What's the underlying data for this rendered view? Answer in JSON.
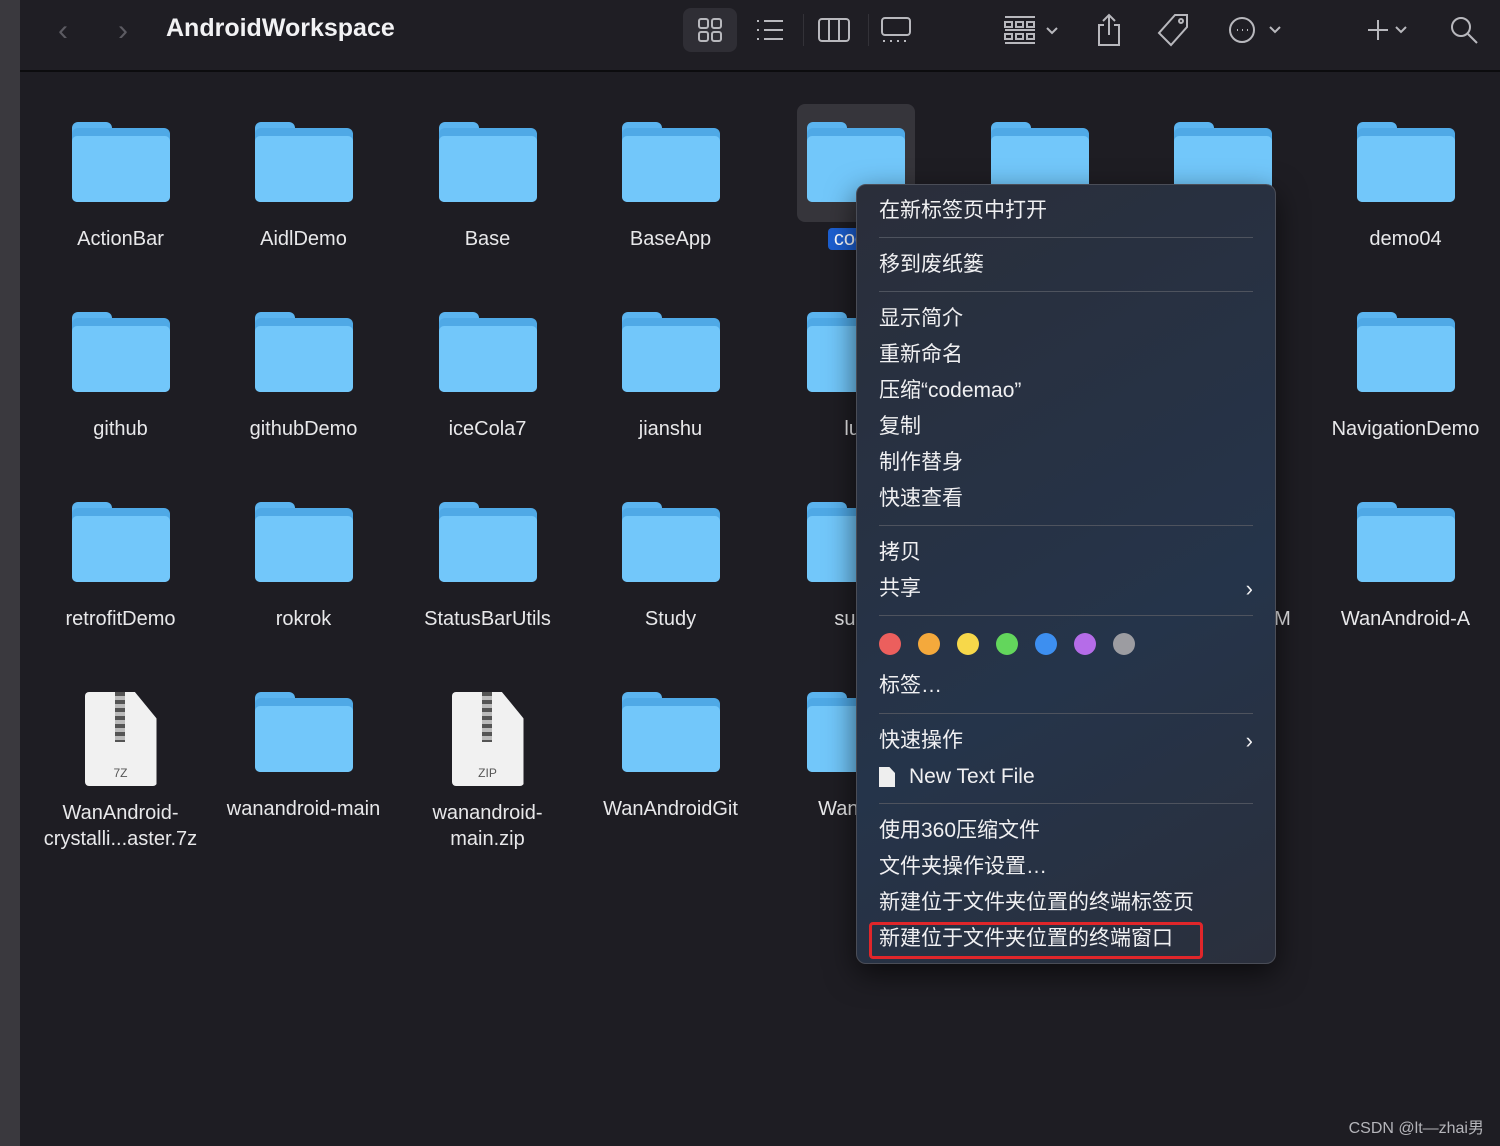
{
  "window": {
    "title": "AndroidWorkspace"
  },
  "toolbar": {
    "back": "‹",
    "forward": "›",
    "icons": [
      "icon-view",
      "list-view",
      "column-view",
      "gallery-view",
      "group-by",
      "share",
      "tag",
      "more-actions",
      "add",
      "search"
    ]
  },
  "items": [
    {
      "name": "ActionBar",
      "type": "folder"
    },
    {
      "name": "AidlDemo",
      "type": "folder"
    },
    {
      "name": "Base",
      "type": "folder"
    },
    {
      "name": "BaseApp",
      "type": "folder"
    },
    {
      "name": "code",
      "type": "folder",
      "selected": true
    },
    {
      "name": "",
      "type": "folder"
    },
    {
      "name": "",
      "type": "folder"
    },
    {
      "name": "demo04",
      "type": "folder"
    },
    {
      "name": "github",
      "type": "folder"
    },
    {
      "name": "githubDemo",
      "type": "folder"
    },
    {
      "name": "iceCola7",
      "type": "folder"
    },
    {
      "name": "jianshu",
      "type": "folder"
    },
    {
      "name": "lur",
      "type": "folder"
    },
    {
      "name": "",
      "type": "none"
    },
    {
      "name": "",
      "type": "none"
    },
    {
      "name": "NavigationDemo",
      "type": "folder"
    },
    {
      "name": "retrofitDemo",
      "type": "folder"
    },
    {
      "name": "rokrok",
      "type": "folder"
    },
    {
      "name": "StatusBarUtils",
      "type": "folder"
    },
    {
      "name": "Study",
      "type": "folder"
    },
    {
      "name": "sunfl",
      "type": "folder"
    },
    {
      "name": "",
      "type": "none"
    },
    {
      "name": "kM",
      "type": "none"
    },
    {
      "name": "WanAndroid-A",
      "type": "folder"
    },
    {
      "name": "WanAndroid-\ncrystalli...aster.7z",
      "type": "archive",
      "ext": "7Z"
    },
    {
      "name": "wanandroid-main",
      "type": "folder"
    },
    {
      "name": "wanandroid-\nmain.zip",
      "type": "archive",
      "ext": "ZIP"
    },
    {
      "name": "WanAndroidGit",
      "type": "folder"
    },
    {
      "name": "WanAnc",
      "type": "folder"
    }
  ],
  "context_menu": {
    "open_new_tab": "在新标签页中打开",
    "move_to_trash": "移到废纸篓",
    "get_info": "显示简介",
    "rename": "重新命名",
    "compress": "压缩“codemao”",
    "duplicate": "复制",
    "make_alias": "制作替身",
    "quick_look": "快速查看",
    "copy": "拷贝",
    "share": "共享",
    "tag_colors": [
      "#ec5f5d",
      "#f4a93c",
      "#f7d84a",
      "#63d65c",
      "#3d8ff0",
      "#b56ce8",
      "#9c9ca1"
    ],
    "tags": "标签…",
    "quick_actions": "快速操作",
    "new_text_file": "New Text File",
    "compress_360": "使用360压缩文件",
    "folder_action_settings": "文件夹操作设置…",
    "new_terminal_tab": "新建位于文件夹位置的终端标签页",
    "new_terminal_window": "新建位于文件夹位置的终端窗口"
  },
  "highlight_color": "#e0262a",
  "watermark": "CSDN @lt—zhai男"
}
